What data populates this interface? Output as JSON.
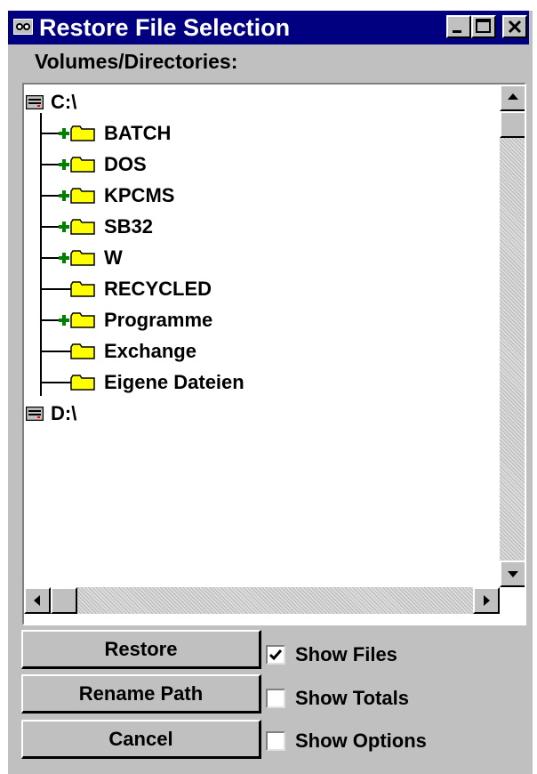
{
  "window": {
    "title": "Restore File Selection",
    "colors": {
      "titlebar": "#000080",
      "face": "#c0c0c0",
      "folder": "#ffff00",
      "expand_plus": "#008000"
    }
  },
  "title_buttons": [
    {
      "name": "minimize-button",
      "icon": "minimize-icon"
    },
    {
      "name": "maximize-button",
      "icon": "maximize-icon"
    },
    {
      "name": "close-button",
      "icon": "close-icon"
    }
  ],
  "tree": {
    "label": "Volumes/Directories:",
    "drives": [
      {
        "label": "C:\\",
        "icon": "drive-icon",
        "children": [
          {
            "label": "BATCH",
            "expandable": true
          },
          {
            "label": "DOS",
            "expandable": true
          },
          {
            "label": "KPCMS",
            "expandable": true
          },
          {
            "label": "SB32",
            "expandable": true
          },
          {
            "label": "W",
            "expandable": true
          },
          {
            "label": "RECYCLED",
            "expandable": false
          },
          {
            "label": "Programme",
            "expandable": true
          },
          {
            "label": "Exchange",
            "expandable": false
          },
          {
            "label": "Eigene Dateien",
            "expandable": false
          }
        ]
      },
      {
        "label": "D:\\",
        "icon": "drive-icon",
        "children": []
      }
    ]
  },
  "buttons": {
    "restore": "Restore",
    "rename_path": "Rename Path",
    "cancel": "Cancel"
  },
  "checkboxes": [
    {
      "label": "Show Files",
      "checked": true
    },
    {
      "label": "Show Totals",
      "checked": false
    },
    {
      "label": "Show Options",
      "checked": false
    }
  ]
}
